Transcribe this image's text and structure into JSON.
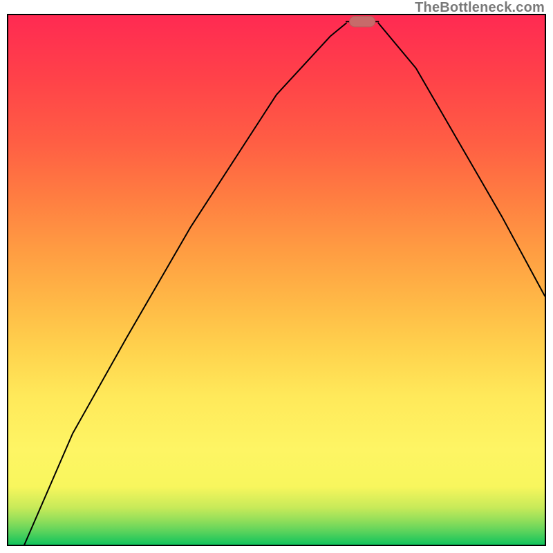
{
  "watermark": "TheBottleneck.com",
  "palette": {
    "axis": "#000000",
    "curve": "#000000",
    "marker_fill": "#c76a6a",
    "marker_stroke": "#b95a5a"
  },
  "chart_data": {
    "type": "line",
    "title": "",
    "xlabel": "",
    "ylabel": "",
    "xlim": [
      0,
      100
    ],
    "ylim": [
      0,
      100
    ],
    "background_bands": [
      {
        "y_from": 100,
        "y_to": 98,
        "color": "#10c45c"
      },
      {
        "y_from": 98,
        "y_to": 96.5,
        "color": "#5bd35c"
      },
      {
        "y_from": 96.5,
        "y_to": 95,
        "color": "#8fde5a"
      },
      {
        "y_from": 95,
        "y_to": 92,
        "color": "#c7ea59"
      },
      {
        "y_from": 92,
        "y_to": 87,
        "color": "#f8f65d"
      },
      {
        "y_from": 87,
        "y_to": 80,
        "color": "#fef564"
      },
      {
        "y_from": 80,
        "y_to": 72,
        "color": "#ffe95a"
      },
      {
        "y_from": 72,
        "y_to": 60,
        "color": "#ffd24d"
      },
      {
        "y_from": 60,
        "y_to": 50,
        "color": "#ffb846"
      },
      {
        "y_from": 50,
        "y_to": 40,
        "color": "#ff9b42"
      },
      {
        "y_from": 40,
        "y_to": 30,
        "color": "#ff7c41"
      },
      {
        "y_from": 30,
        "y_to": 20,
        "color": "#ff5e44"
      },
      {
        "y_from": 20,
        "y_to": 10,
        "color": "#ff4249"
      },
      {
        "y_from": 10,
        "y_to": 0,
        "color": "#ff2a52"
      }
    ],
    "curve_segments": [
      [
        {
          "x": 3,
          "y": 0
        },
        {
          "x": 12,
          "y": 21
        },
        {
          "x": 22,
          "y": 39
        },
        {
          "x": 34,
          "y": 60
        },
        {
          "x": 50,
          "y": 85
        },
        {
          "x": 60,
          "y": 96
        },
        {
          "x": 63,
          "y": 98.5
        }
      ],
      [
        {
          "x": 63,
          "y": 98.8
        },
        {
          "x": 69,
          "y": 98.8
        }
      ],
      [
        {
          "x": 69,
          "y": 98.5
        },
        {
          "x": 76,
          "y": 90
        },
        {
          "x": 84,
          "y": 76
        },
        {
          "x": 92,
          "y": 62
        },
        {
          "x": 100,
          "y": 47
        }
      ]
    ],
    "marker": {
      "x": 66,
      "y": 98.8,
      "rx": 2.4,
      "ry": 1.0
    }
  }
}
